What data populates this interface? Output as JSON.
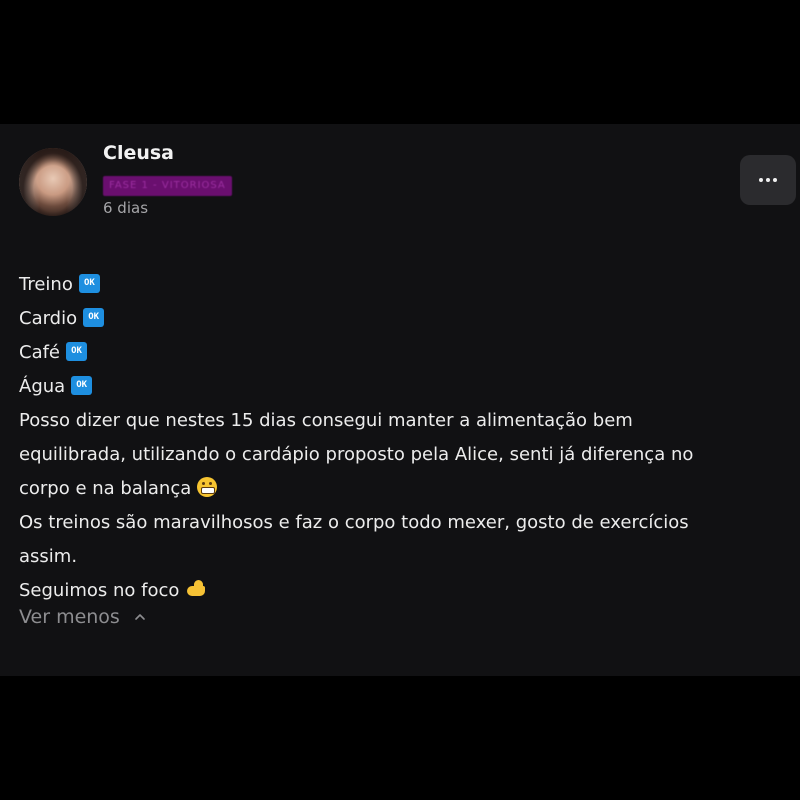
{
  "post": {
    "author": "Cleusa",
    "badge": "FASE 1 - VITORIOSA",
    "time": "6 dias",
    "more_icon": "ellipsis-icon",
    "lines": {
      "l1": "Treino",
      "l2": "Cardio",
      "l3": "Café",
      "l4": "Água",
      "l5": "Posso dizer que nestes 15 dias consegui manter a alimentação bem",
      "l6": "equilibrada, utilizando o cardápio proposto pela Alice, senti já diferença no",
      "l7": "corpo e na balança",
      "l8": "Os treinos são maravilhosos e faz o corpo todo mexer, gosto de exercícios",
      "l9": "assim.",
      "l10": "Seguimos no foco"
    },
    "ok_label": "OK",
    "see_less": "Ver menos"
  },
  "colors": {
    "background": "#111113",
    "badge_bg": "#6a0f6f",
    "ok_blue": "#1e8fe0",
    "muted": "#8d8d90"
  }
}
